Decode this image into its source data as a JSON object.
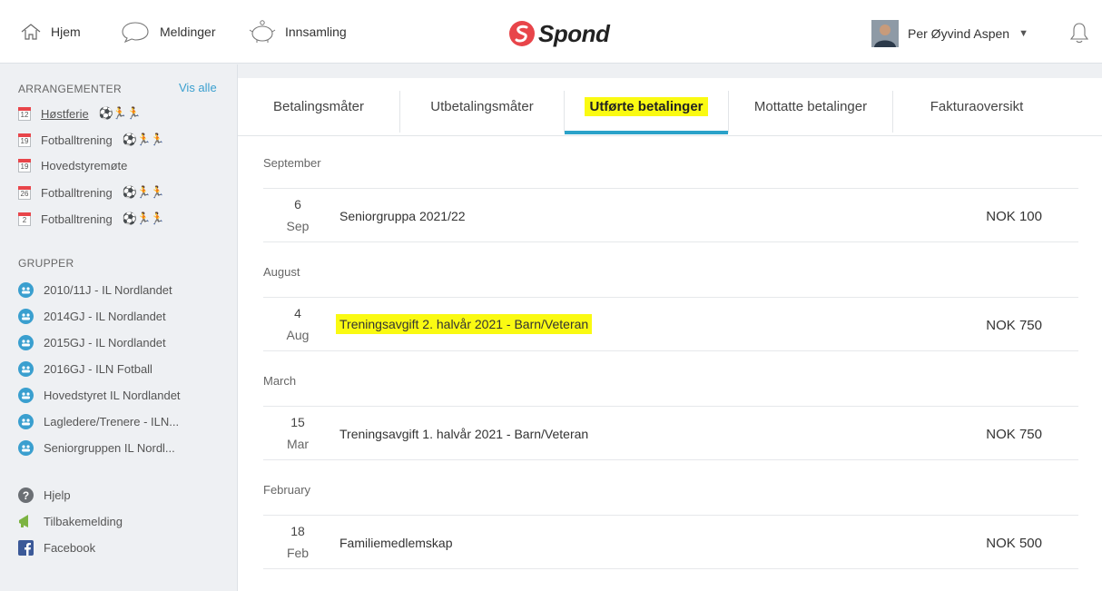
{
  "header": {
    "nav": [
      {
        "label": "Hjem",
        "icon": "home-icon"
      },
      {
        "label": "Meldinger",
        "icon": "speech-bubble-icon"
      },
      {
        "label": "Innsamling",
        "icon": "piggy-bank-icon"
      }
    ],
    "brand": "Spond",
    "user_name": "Per Øyvind Aspen",
    "caret": "▼"
  },
  "sidebar": {
    "events_heading": "ARRANGEMENTER",
    "see_all": "Vis alle",
    "events": [
      {
        "day": "12",
        "label": "Høstferie"
      },
      {
        "day": "19",
        "label": "Fotballtrening"
      },
      {
        "day": "19",
        "label": "Hovedstyremøte"
      },
      {
        "day": "26",
        "label": "Fotballtrening"
      },
      {
        "day": "2",
        "label": "Fotballtrening"
      }
    ],
    "groups_heading": "GRUPPER",
    "groups": [
      {
        "label": "2010/11J - IL Nordlandet"
      },
      {
        "label": "2014GJ - IL Nordlandet"
      },
      {
        "label": "2015GJ - IL Nordlandet"
      },
      {
        "label": "2016GJ - ILN Fotball"
      },
      {
        "label": "Hovedstyret IL Nordlandet"
      },
      {
        "label": "Lagledere/Trenere - ILN..."
      },
      {
        "label": "Seniorgruppen IL Nordl..."
      }
    ],
    "links": [
      {
        "label": "Hjelp",
        "icon": "help-icon"
      },
      {
        "label": "Tilbakemelding",
        "icon": "megaphone-icon"
      },
      {
        "label": "Facebook",
        "icon": "facebook-icon"
      }
    ]
  },
  "tabs": [
    {
      "label": "Betalingsmåter"
    },
    {
      "label": "Utbetalingsmåter"
    },
    {
      "label": "Utførte betalinger",
      "active": true
    },
    {
      "label": "Mottatte betalinger"
    },
    {
      "label": "Fakturaoversikt"
    }
  ],
  "payments": [
    {
      "month": "September",
      "day": "6",
      "mon": "Sep",
      "title": "Seniorgruppa 2021/22",
      "amount": "NOK 100"
    },
    {
      "month": "August",
      "day": "4",
      "mon": "Aug",
      "title": "Treningsavgift 2. halvår 2021 - Barn/Veteran",
      "amount": "NOK 750",
      "highlighted": true
    },
    {
      "month": "March",
      "day": "15",
      "mon": "Mar",
      "title": "Treningsavgift 1. halvår 2021 - Barn/Veteran",
      "amount": "NOK 750"
    },
    {
      "month": "February",
      "day": "18",
      "mon": "Feb",
      "title": "Familiemedlemskap",
      "amount": "NOK 500"
    }
  ],
  "colors": {
    "accent": "#2ba2c9",
    "highlight": "#fafa12",
    "brand_red": "#e8454a",
    "group_blue": "#3a9fcf"
  }
}
